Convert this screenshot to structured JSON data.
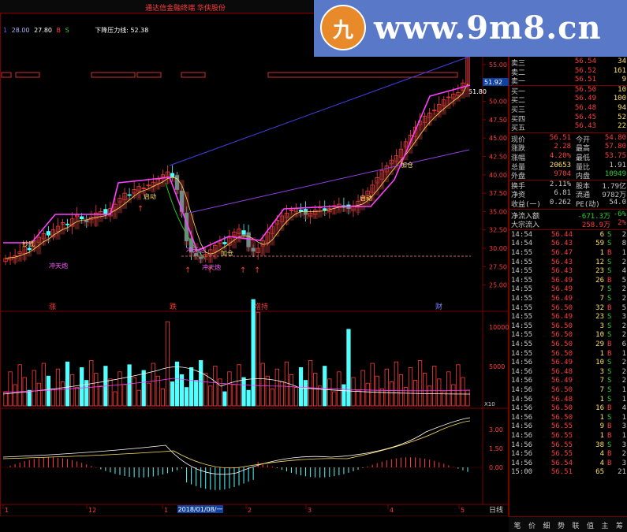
{
  "app_title": "通达信金融终端  华侠股份",
  "window_buttons": [
    "_",
    "□",
    "×"
  ],
  "legend": {
    "items": [
      {
        "text": "1",
        "color": "#6060ff"
      },
      {
        "text": "28.00",
        "color": "#b0b0ff"
      },
      {
        "text": "27.80",
        "color": "#ffffff"
      },
      {
        "text": "B",
        "color": "#ff3c3c"
      },
      {
        "text": "S",
        "color": "#30d030"
      }
    ],
    "resistance_label": "下降压力线: 52.38"
  },
  "price_axis": {
    "ticks": [
      "55.00",
      "52.50",
      "50.00",
      "47.50",
      "45.00",
      "42.50",
      "40.00",
      "37.50",
      "35.00",
      "32.50",
      "30.00",
      "27.50",
      "25.00"
    ],
    "current": "51.92",
    "current_tag": "51.80"
  },
  "annotations": {
    "signals_bottom": [
      "涨",
      "跌",
      "增持",
      "财"
    ],
    "labels": [
      "冲天炮",
      "冲天炮",
      "冲天炮",
      "抄底",
      "启动",
      "加仓",
      "启动",
      "加仓"
    ]
  },
  "volume_axis": {
    "ticks": [
      "10000",
      "5000"
    ],
    "unit": "X10"
  },
  "macd_axis": {
    "ticks": [
      "3.00",
      "1.50",
      "0.00"
    ]
  },
  "time_axis": {
    "labels": [
      "1",
      "12",
      "1",
      "2",
      "3",
      "4",
      "5"
    ],
    "highlight": "2018/01/08/一",
    "period": "日线"
  },
  "order_book": [
    {
      "label": "卖三",
      "price": "56.54",
      "vol": "34"
    },
    {
      "label": "卖二",
      "price": "56.52",
      "vol": "161"
    },
    {
      "label": "卖一",
      "price": "56.51",
      "vol": "9"
    },
    {
      "label": "买一",
      "price": "56.50",
      "vol": "10"
    },
    {
      "label": "买二",
      "price": "56.49",
      "vol": "100"
    },
    {
      "label": "买三",
      "price": "56.48",
      "vol": "94"
    },
    {
      "label": "买四",
      "price": "56.45",
      "vol": "52"
    },
    {
      "label": "买五",
      "price": "56.43",
      "vol": "22"
    }
  ],
  "quote": [
    {
      "l1": "现价",
      "v1": "56.51",
      "l2": "今开",
      "v2": "54.80"
    },
    {
      "l1": "涨跌",
      "v1": "2.28",
      "l2": "最高",
      "v2": "57.80"
    },
    {
      "l1": "涨幅",
      "v1": "4.20%",
      "l2": "最低",
      "v2": "53.75"
    },
    {
      "l1": "总量",
      "v1": "20653",
      "l2": "量比",
      "v2": "1.91"
    },
    {
      "l1": "外盘",
      "v1": "9704",
      "l2": "内盘",
      "v2": "10949"
    },
    {
      "l1": "换手",
      "v1": "2.11%",
      "l2": "股本",
      "v2": "1.79亿"
    },
    {
      "l1": "净资",
      "v1": "6.81",
      "l2": "流通",
      "v2": "9782万"
    },
    {
      "l1": "收益(一)",
      "v1": "0.262",
      "l2": "PE(动)",
      "v2": "54.0"
    }
  ],
  "flow": [
    {
      "label": "净流入额",
      "value": "-671.3万",
      "pct": "-6%"
    },
    {
      "label": "大宗流入",
      "value": "258.9万",
      "pct": "2%"
    }
  ],
  "ticks": [
    [
      "14:54",
      "56.44",
      "6",
      "S",
      "2"
    ],
    [
      "14:54",
      "56.43",
      "59",
      "S",
      "8"
    ],
    [
      "14:55",
      "56.47",
      "1",
      "B",
      "1"
    ],
    [
      "14:55",
      "56.43",
      "12",
      "S",
      "2"
    ],
    [
      "14:55",
      "56.43",
      "23",
      "S",
      "4"
    ],
    [
      "14:55",
      "56.49",
      "26",
      "B",
      "5"
    ],
    [
      "14:55",
      "56.49",
      "7",
      "S",
      "2"
    ],
    [
      "14:55",
      "56.49",
      "7",
      "S",
      "2"
    ],
    [
      "14:55",
      "56.50",
      "32",
      "B",
      "5"
    ],
    [
      "14:55",
      "56.49",
      "23",
      "S",
      "3"
    ],
    [
      "14:55",
      "56.50",
      "3",
      "S",
      "2"
    ],
    [
      "14:55",
      "56.50",
      "10",
      "S",
      "2"
    ],
    [
      "14:55",
      "56.50",
      "29",
      "B",
      "6"
    ],
    [
      "14:55",
      "56.50",
      "1",
      "B",
      "1"
    ],
    [
      "14:56",
      "56.49",
      "10",
      "S",
      "2"
    ],
    [
      "14:56",
      "56.48",
      "3",
      "S",
      "2"
    ],
    [
      "14:56",
      "56.49",
      "7",
      "S",
      "2"
    ],
    [
      "14:56",
      "56.50",
      "7",
      "S",
      "1"
    ],
    [
      "14:56",
      "56.48",
      "1",
      "S",
      "1"
    ],
    [
      "14:56",
      "56.50",
      "16",
      "B",
      "4"
    ],
    [
      "14:56",
      "56.50",
      "1",
      "S",
      "1"
    ],
    [
      "14:56",
      "56.55",
      "9",
      "B",
      "3"
    ],
    [
      "14:56",
      "56.55",
      "1",
      "B",
      "1"
    ],
    [
      "14:56",
      "56.55",
      "38",
      "S",
      "3"
    ],
    [
      "14:56",
      "56.55",
      "4",
      "B",
      "2"
    ],
    [
      "14:56",
      "56.54",
      "4",
      "B",
      "3"
    ],
    [
      "15:00",
      "56.51",
      "65",
      "",
      "21"
    ]
  ],
  "bottom_tabs": [
    "笔",
    "价",
    "细",
    "势",
    "联",
    "值",
    "主",
    "筹"
  ],
  "watermark": {
    "logo_char": "九",
    "text": "www.9m8.cn"
  },
  "colors": {
    "up": "#ff3c3c",
    "down": "#50ffff",
    "ma": "#ff40ff",
    "grid": "#7a0000",
    "buy": "#ff3c3c",
    "sell": "#30d030"
  }
}
